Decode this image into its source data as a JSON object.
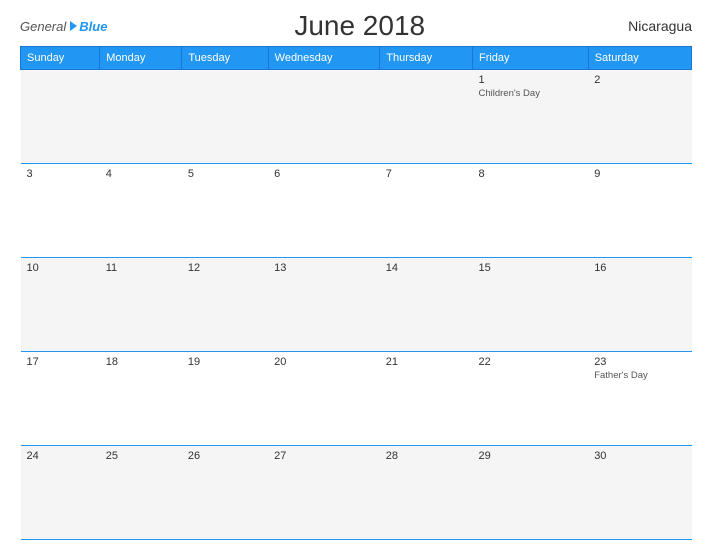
{
  "header": {
    "logo_general": "General",
    "logo_blue": "Blue",
    "title": "June 2018",
    "country": "Nicaragua"
  },
  "columns": [
    "Sunday",
    "Monday",
    "Tuesday",
    "Wednesday",
    "Thursday",
    "Friday",
    "Saturday"
  ],
  "weeks": [
    [
      {
        "day": "",
        "holiday": ""
      },
      {
        "day": "",
        "holiday": ""
      },
      {
        "day": "",
        "holiday": ""
      },
      {
        "day": "",
        "holiday": ""
      },
      {
        "day": "",
        "holiday": ""
      },
      {
        "day": "1",
        "holiday": "Children's Day"
      },
      {
        "day": "2",
        "holiday": ""
      }
    ],
    [
      {
        "day": "3",
        "holiday": ""
      },
      {
        "day": "4",
        "holiday": ""
      },
      {
        "day": "5",
        "holiday": ""
      },
      {
        "day": "6",
        "holiday": ""
      },
      {
        "day": "7",
        "holiday": ""
      },
      {
        "day": "8",
        "holiday": ""
      },
      {
        "day": "9",
        "holiday": ""
      }
    ],
    [
      {
        "day": "10",
        "holiday": ""
      },
      {
        "day": "11",
        "holiday": ""
      },
      {
        "day": "12",
        "holiday": ""
      },
      {
        "day": "13",
        "holiday": ""
      },
      {
        "day": "14",
        "holiday": ""
      },
      {
        "day": "15",
        "holiday": ""
      },
      {
        "day": "16",
        "holiday": ""
      }
    ],
    [
      {
        "day": "17",
        "holiday": ""
      },
      {
        "day": "18",
        "holiday": ""
      },
      {
        "day": "19",
        "holiday": ""
      },
      {
        "day": "20",
        "holiday": ""
      },
      {
        "day": "21",
        "holiday": ""
      },
      {
        "day": "22",
        "holiday": ""
      },
      {
        "day": "23",
        "holiday": "Father's Day"
      }
    ],
    [
      {
        "day": "24",
        "holiday": ""
      },
      {
        "day": "25",
        "holiday": ""
      },
      {
        "day": "26",
        "holiday": ""
      },
      {
        "day": "27",
        "holiday": ""
      },
      {
        "day": "28",
        "holiday": ""
      },
      {
        "day": "29",
        "holiday": ""
      },
      {
        "day": "30",
        "holiday": ""
      }
    ]
  ]
}
